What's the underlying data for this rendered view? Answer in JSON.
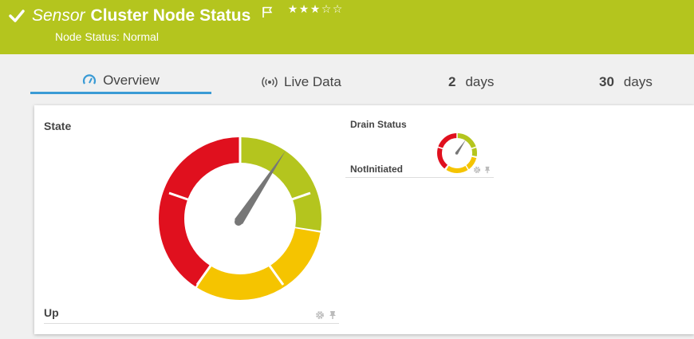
{
  "header": {
    "title_prefix": "Sensor",
    "title_name": "Cluster Node Status",
    "status": "Node Status: Normal",
    "stars": [
      "★",
      "★",
      "★",
      "☆",
      "☆"
    ],
    "bg_color": "#b4c51e"
  },
  "tabs": [
    {
      "label": "Overview",
      "icon": "gauge-icon",
      "active": true
    },
    {
      "label": "Live Data",
      "icon": "live-signal-icon"
    },
    {
      "num": "2",
      "label": "days"
    },
    {
      "num": "30",
      "label": "days"
    }
  ],
  "channels": {
    "state": {
      "name": "State",
      "value": "Up",
      "gauge_colors": [
        "#b4c51e",
        "#f5c400",
        "#e0101e"
      ]
    },
    "drain": {
      "name": "Drain Status",
      "value": "NotInitiated"
    }
  }
}
